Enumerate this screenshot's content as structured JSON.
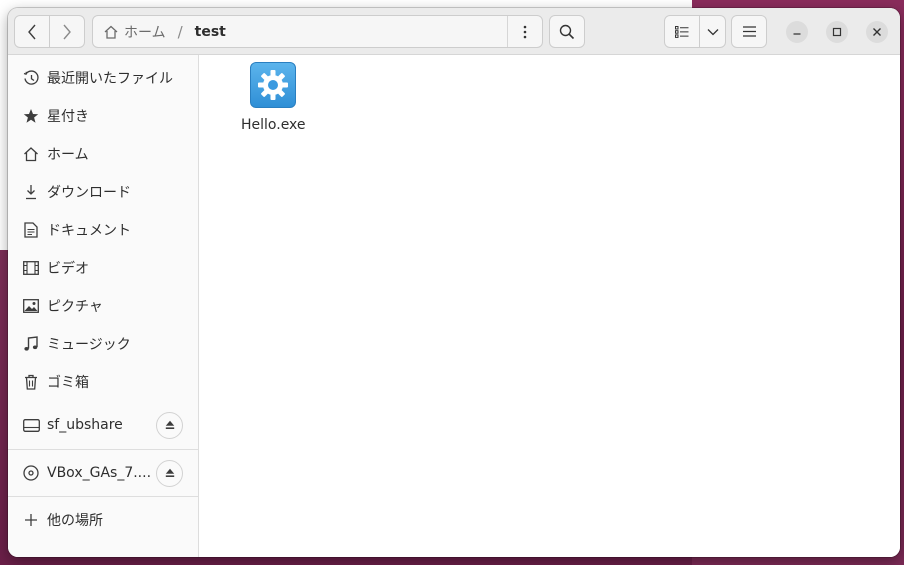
{
  "window": {
    "title": "test"
  },
  "header": {
    "breadcrumb_home": "ホーム",
    "breadcrumb_separator": "/",
    "breadcrumb_current": "test"
  },
  "sidebar": {
    "items": [
      {
        "label": "最近開いたファイル",
        "icon": "recent-clock-icon"
      },
      {
        "label": "星付き",
        "icon": "star-icon"
      },
      {
        "label": "ホーム",
        "icon": "home-icon"
      },
      {
        "label": "ダウンロード",
        "icon": "download-icon"
      },
      {
        "label": "ドキュメント",
        "icon": "document-icon"
      },
      {
        "label": "ビデオ",
        "icon": "video-film-icon"
      },
      {
        "label": "ピクチャ",
        "icon": "picture-icon"
      },
      {
        "label": "ミュージック",
        "icon": "music-note-icon"
      },
      {
        "label": "ゴミ箱",
        "icon": "trash-icon"
      }
    ],
    "devices": [
      {
        "label": "sf_ubshare",
        "icon": "drive-icon"
      },
      {
        "label": "VBox_GAs_7....",
        "icon": "optical-disc-icon"
      }
    ],
    "other_locations": "他の場所"
  },
  "content": {
    "files": [
      {
        "name": "Hello.exe",
        "icon": "executable-gear-icon"
      }
    ]
  },
  "colors": {
    "header_bg": "#ebebeb",
    "sidebar_bg": "#fafafa",
    "file_icon_blue": "#3a9ae0",
    "desktop_bg": "#7a2b55"
  }
}
